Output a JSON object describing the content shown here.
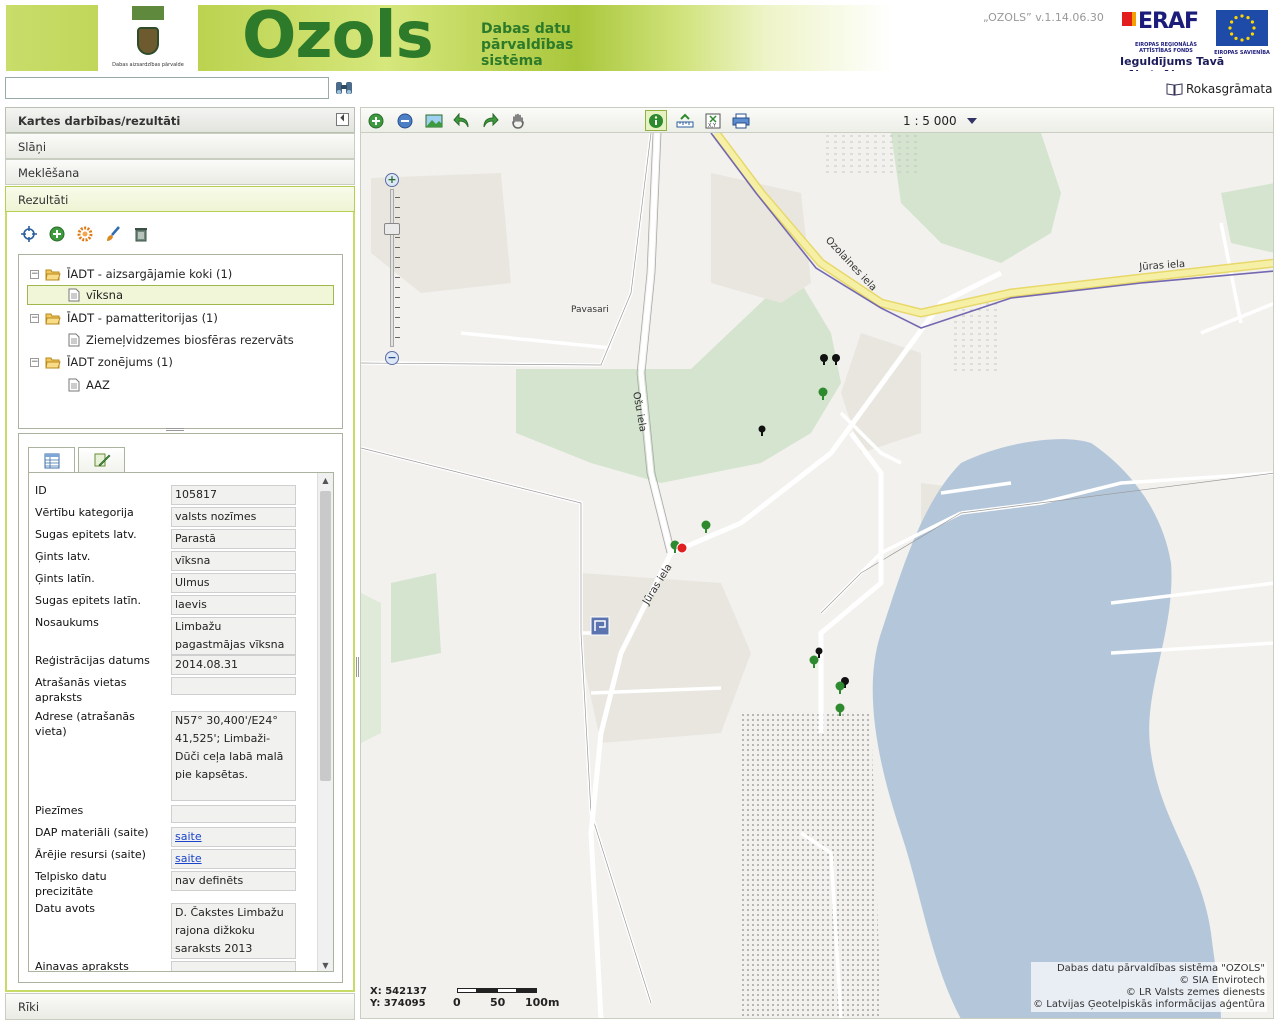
{
  "banner": {
    "logo_caption": "Dabas aizsardzības pārvalde",
    "brand": "Ozols",
    "subtitle": "Dabas datu\npārvaldības\nsistēma",
    "version": "„OZOLS” v.1.14.06.30",
    "eraf_logo": "ERAF",
    "eraf_caption": "EIROPAS REĢIONĀLĀS ATTĪSTĪBAS FONDS",
    "eu_caption": "EIROPAS SAVIENĪBA",
    "slogan": "Ieguldījums Tavā nākotnē!"
  },
  "search": {
    "value": "",
    "placeholder": ""
  },
  "manual_label": "Rokasgrāmata",
  "left_panel": {
    "main_title": "Kartes darbības/rezultāti",
    "sections": {
      "slani": "Slāņi",
      "meklesana": "Meklēšana",
      "rezultati": "Rezultāti",
      "riki": "Rīki"
    }
  },
  "tree": [
    {
      "label": "ĪADT - aizsargājamie koki (1)",
      "child": "vīksna"
    },
    {
      "label": "ĪADT - pamatteritorijas (1)",
      "child": "Ziemeļvidzemes biosfēras rezervāts"
    },
    {
      "label": "ĪADT zonējums (1)",
      "child": "AAZ"
    }
  ],
  "attributes": [
    {
      "label": "ID",
      "value": "105817"
    },
    {
      "label": "Vērtību kategorija",
      "value": "valsts nozīmes"
    },
    {
      "label": "Sugas epitets latv.",
      "value": "Parastā"
    },
    {
      "label": "Ģints latv.",
      "value": "vīksna"
    },
    {
      "label": "Ģints latīn.",
      "value": "Ulmus"
    },
    {
      "label": "Sugas epitets latīn.",
      "value": "laevis"
    },
    {
      "label": "Nosaukums",
      "value": "Limbažu pagastmājas vīksna"
    },
    {
      "label": "Reģistrācijas datums",
      "value": "2014.08.31"
    },
    {
      "label": "Atrašanās vietas apraksts",
      "value": ""
    },
    {
      "label": "Adrese (atrašanās vieta)",
      "value": "N57° 30,400'/E24° 41,525'; Limbaži-Dūči ceļa labā malā pie kapsētas."
    },
    {
      "label": "Piezīmes",
      "value": ""
    },
    {
      "label": "DAP materiāli (saite)",
      "value": "saite"
    },
    {
      "label": "Ārējie resursi (saite)",
      "value": "saite"
    },
    {
      "label": "Telpisko datu precizitāte",
      "value": "nav definēts"
    },
    {
      "label": "Datu avots",
      "value": "D. Čakstes Limbažu rajona dižkoku saraksts 2013"
    },
    {
      "label": "Ainavas apraksts",
      "value": ""
    }
  ],
  "map": {
    "scale": "1 : 5 000",
    "streets": {
      "ozolaines": "Ozolaines iela",
      "juras_top": "Jūras iela",
      "osu": "Ošu iela",
      "juras": "Jūras iela"
    },
    "place": "Pavasari",
    "coords": {
      "x": "X: 542137",
      "y": "Y: 374095"
    },
    "scalebar": [
      "0",
      "50",
      "100m"
    ],
    "attribution": [
      "Dabas datu pārvaldības sistēma \"OZOLS\"",
      "© SIA Envirotech",
      "© LR Valsts zemes dienests",
      "© Latvijas Ģeotelpiskās informācijas aģentūra"
    ],
    "colors": {
      "forest": "#d4e4cf",
      "water": "#b4c7da",
      "road_main": "#f5f0a6",
      "boundary": "#7468b0"
    }
  }
}
